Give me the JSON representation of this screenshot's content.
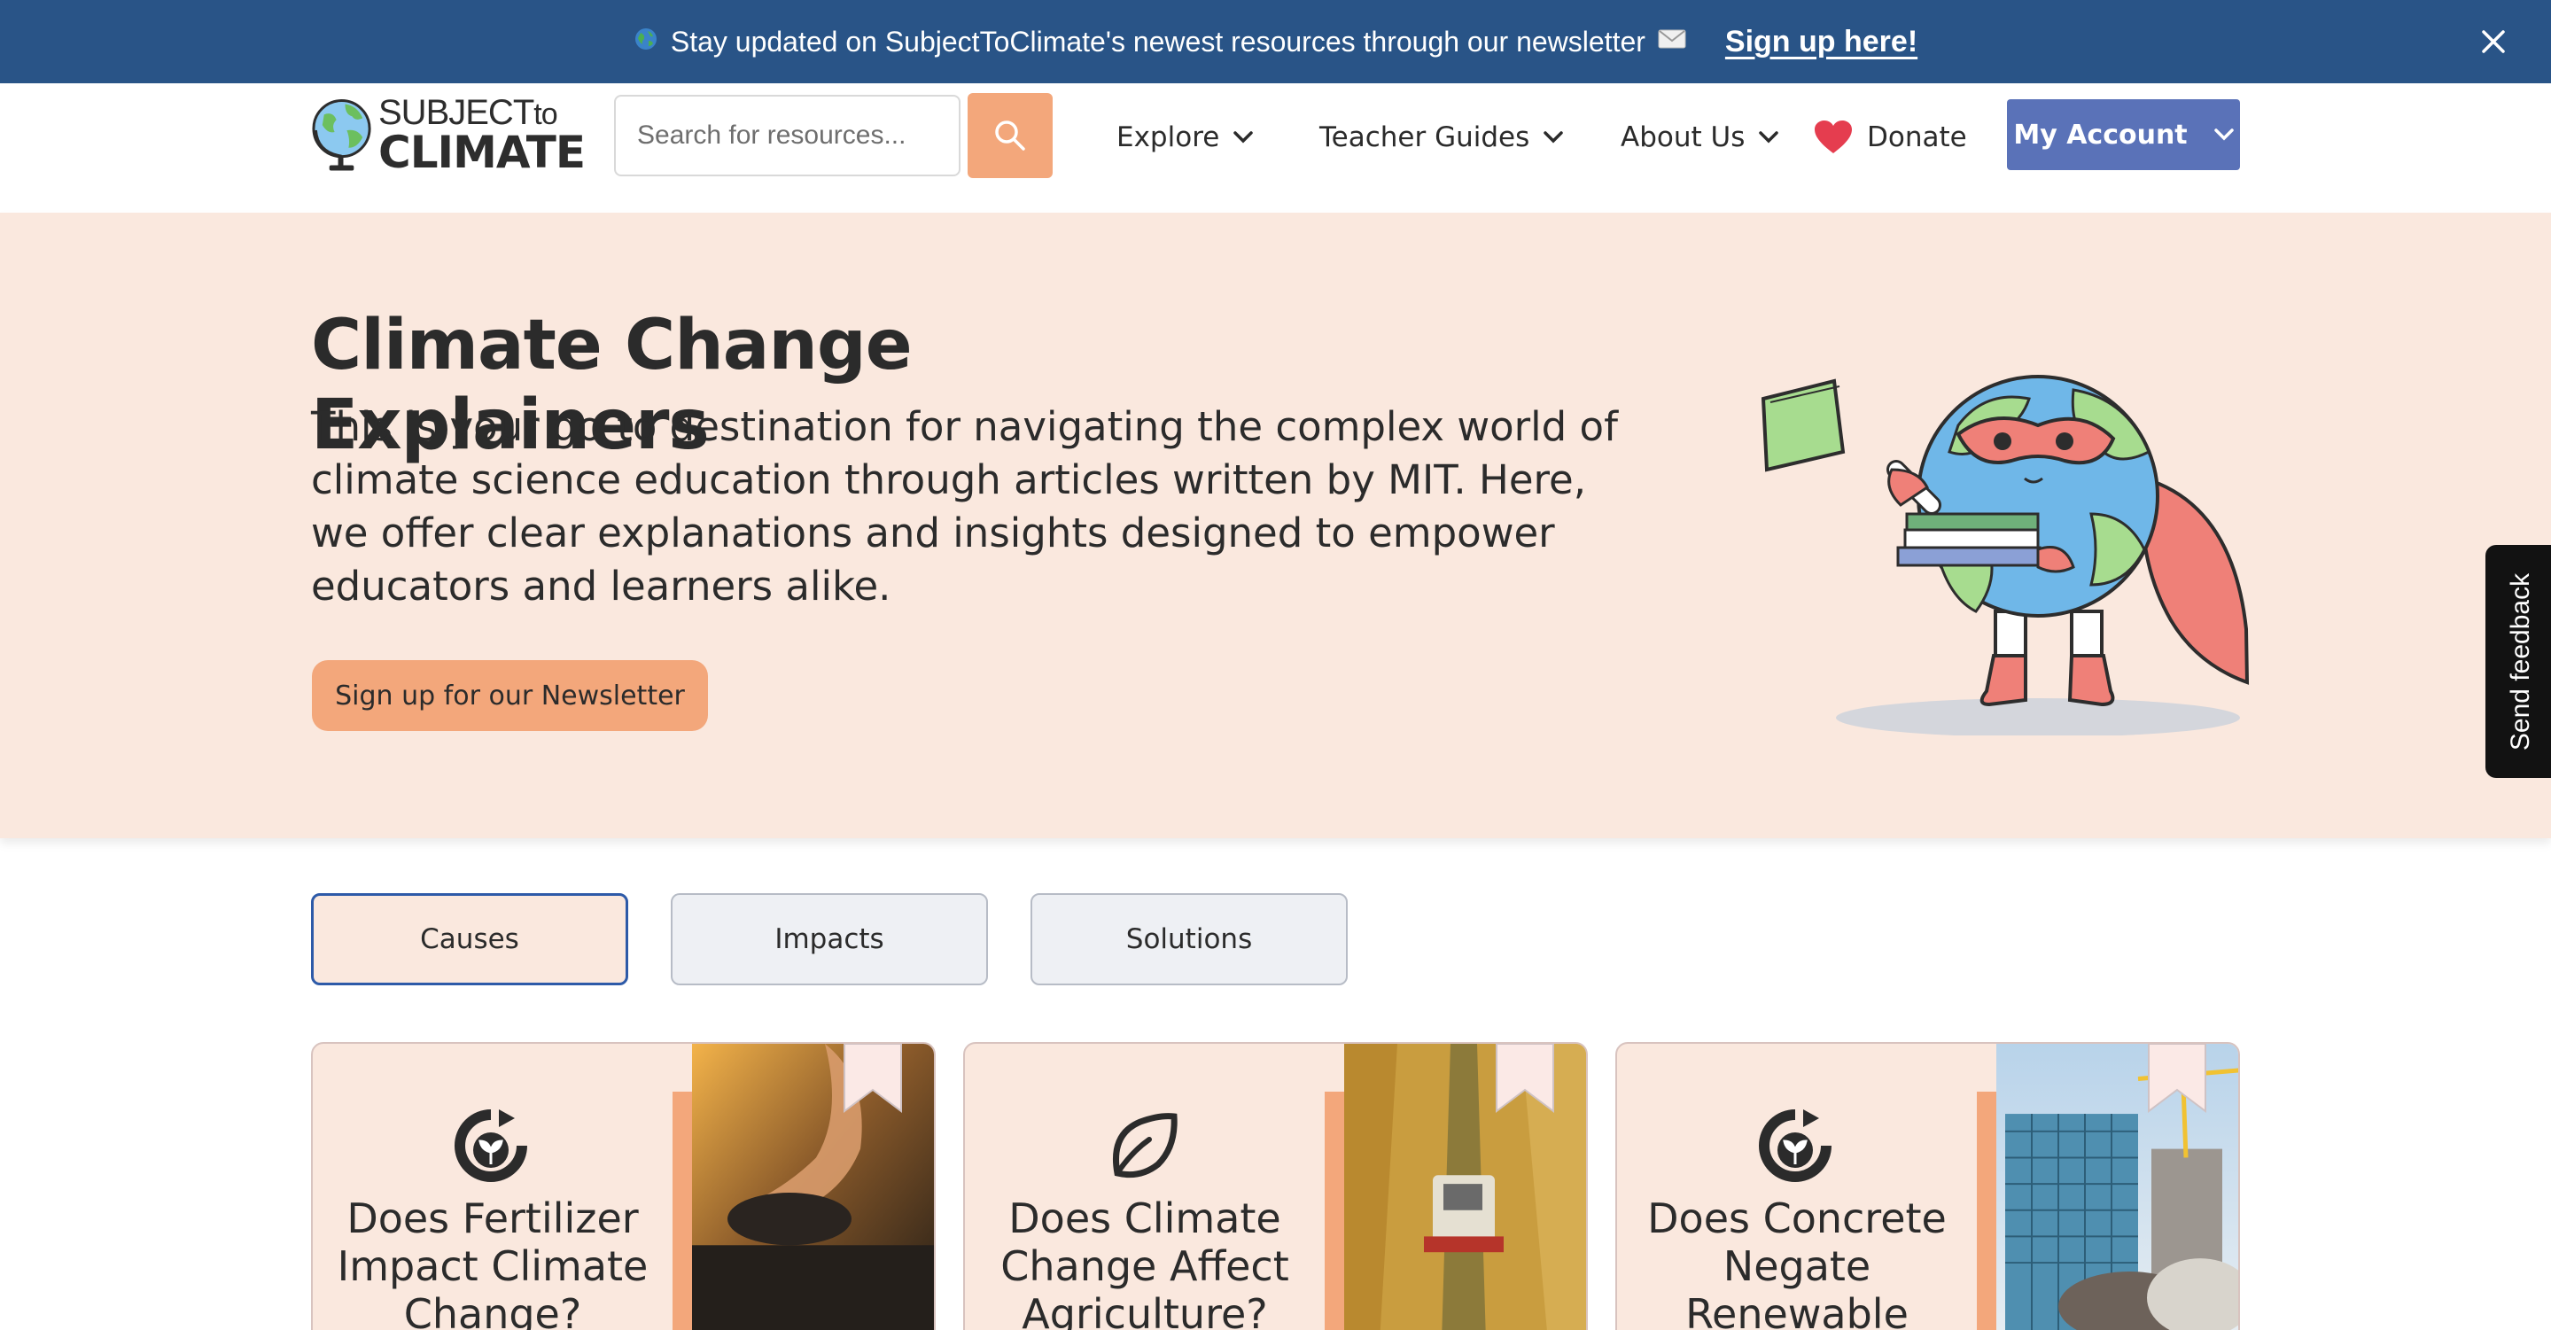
{
  "banner": {
    "message": "Stay updated on SubjectToClimate's newest resources through our newsletter",
    "signup_label": "Sign up here!",
    "lead_icon": "globe-icon",
    "trail_icon": "envelope-icon",
    "close_icon": "close-icon"
  },
  "header": {
    "logo": {
      "line1": "SUBJECT",
      "line1_small": "to",
      "line2": "CLIMATE"
    },
    "search": {
      "placeholder": "Search for resources...",
      "value": ""
    },
    "nav": [
      {
        "label": "Explore"
      },
      {
        "label": "Teacher Guides"
      },
      {
        "label": "About Us"
      },
      {
        "label": "Donate"
      }
    ],
    "account_label": "My Account"
  },
  "hero": {
    "title": "Climate Change Explainers",
    "description": "This is your go-to destination for navigating the complex world of climate science education through articles written by MIT. Here, we offer clear explanations and insights designed to empower educators and learners alike.",
    "newsletter_button": "Sign up for our Newsletter"
  },
  "feedback": {
    "label": "Send feedback"
  },
  "tabs": [
    {
      "label": "Causes",
      "active": true
    },
    {
      "label": "Impacts",
      "active": false
    },
    {
      "label": "Solutions",
      "active": false
    }
  ],
  "cards": [
    {
      "title": "Does Fertilizer Impact Climate Change?",
      "icon": "recycle-sprout-icon"
    },
    {
      "title": "Does Climate Change Affect Agriculture?",
      "icon": "leaf-icon"
    },
    {
      "title": "Does Concrete Negate Renewable",
      "icon": "recycle-sprout-icon"
    }
  ],
  "colors": {
    "banner_bg": "#295487",
    "accent_orange": "#f3a77b",
    "hero_bg": "#fae8de",
    "account_blue": "#5a72b8",
    "heart_red": "#e53d4f",
    "active_tab_border": "#2d5aa8"
  }
}
